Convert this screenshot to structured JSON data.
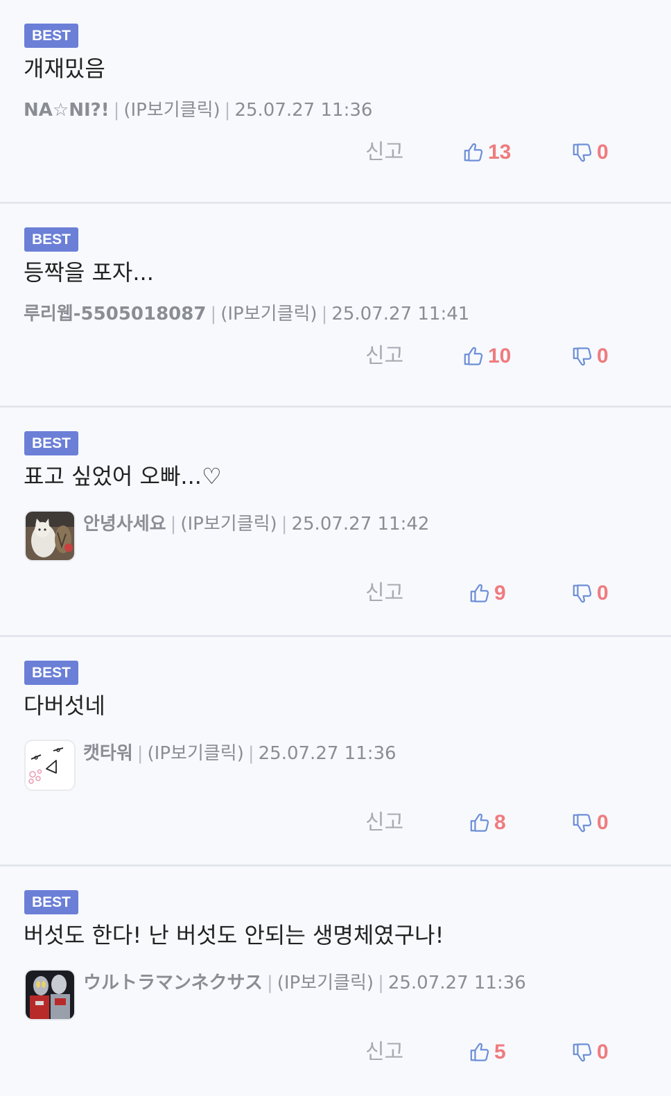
{
  "comments": [
    {
      "badge": "BEST",
      "text": "개재밌음",
      "nickname": "NA☆NI?!",
      "ip_label": "(IP보기클릭)",
      "datetime": "25.07.27 11:36",
      "avatar": null,
      "report_label": "신고",
      "likes": "13",
      "dislikes": "0"
    },
    {
      "badge": "BEST",
      "text": "등짝을 포자...",
      "nickname": "루리웹-5505018087",
      "ip_label": "(IP보기클릭)",
      "datetime": "25.07.27 11:41",
      "avatar": null,
      "report_label": "신고",
      "likes": "10",
      "dislikes": "0"
    },
    {
      "badge": "BEST",
      "text": "표고 싶었어 오빠...♡",
      "nickname": "안녕사세요",
      "ip_label": "(IP보기클릭)",
      "datetime": "25.07.27 11:42",
      "avatar": "cat-photo",
      "report_label": "신고",
      "likes": "9",
      "dislikes": "0"
    },
    {
      "badge": "BEST",
      "text": "다버섯네",
      "nickname": "캣타워",
      "ip_label": "(IP보기클릭)",
      "datetime": "25.07.27 11:36",
      "avatar": "doodle-face",
      "report_label": "신고",
      "likes": "8",
      "dislikes": "0"
    },
    {
      "badge": "BEST",
      "text": "버섯도 한다! 난 버섯도 안되는 생명체였구나!",
      "nickname": "ウルトラマンネクサス",
      "ip_label": "(IP보기클릭)",
      "datetime": "25.07.27 11:36",
      "avatar": "ultraman-figure",
      "report_label": "신고",
      "likes": "5",
      "dislikes": "0"
    }
  ],
  "icons": {
    "like": "thumbs-up-icon",
    "dislike": "thumbs-down-icon"
  },
  "colors": {
    "best_badge": "#6b7fd7",
    "vote_count": "#ef7b7e",
    "thumb_icon": "#6e8fd6",
    "background": "#f7f9fd"
  }
}
